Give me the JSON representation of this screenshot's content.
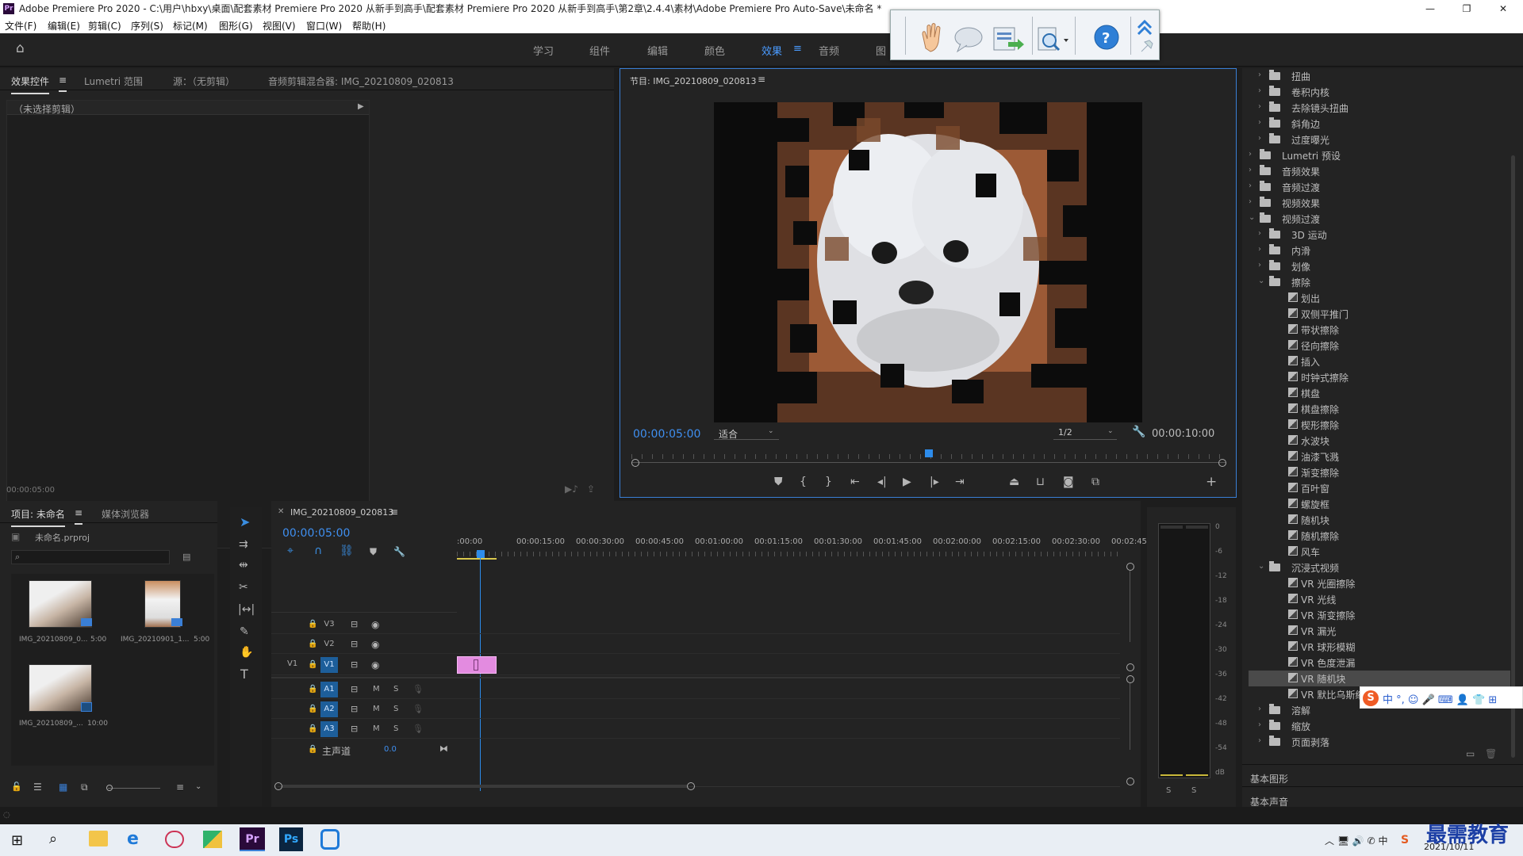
{
  "window": {
    "logo": "Pr",
    "title": "Adobe Premiere Pro 2020 - C:\\用户\\hbxy\\桌面\\配套素材 Premiere Pro 2020 从新手到高手\\配套素材 Premiere Pro 2020 从新手到高手\\第2章\\2.4.4\\素材\\Adobe Premiere Pro Auto-Save\\未命名 *",
    "minimize": "—",
    "maximize": "❐",
    "close": "✕"
  },
  "menu": [
    "文件(F)",
    "编辑(E)",
    "剪辑(C)",
    "序列(S)",
    "标记(M)",
    "图形(G)",
    "视图(V)",
    "窗口(W)",
    "帮助(H)"
  ],
  "workspaces": {
    "items": [
      "学习",
      "组件",
      "编辑",
      "颜色",
      "效果",
      "音频",
      "图"
    ],
    "active": "效果"
  },
  "source_panel": {
    "tabs": [
      "效果控件",
      "Lumetri 范围",
      "源：（无剪辑）",
      "音频剪辑混合器: IMG_20210809_020813"
    ],
    "no_clip": "（未选择剪辑）",
    "timecode": "00:00:05:00"
  },
  "program_panel": {
    "title": "节目: IMG_20210809_020813",
    "timecode": "00:00:05:00",
    "fit": "适合",
    "resolution": "1/2",
    "duration": "00:00:10:00",
    "playhead_fraction": 0.5
  },
  "project_panel": {
    "tabs": [
      "项目: 未命名",
      "媒体浏览器"
    ],
    "file": "未命名.prproj",
    "items": [
      {
        "name": "IMG_20210809_0...",
        "duration": "5:00"
      },
      {
        "name": "IMG_20210901_1...",
        "duration": "5:00"
      },
      {
        "name": "IMG_20210809_...",
        "duration": "10:00"
      }
    ]
  },
  "timeline": {
    "tab": "IMG_20210809_020813",
    "timecode": "00:00:05:00",
    "ruler": [
      ":00:00",
      "00:00:15:00",
      "00:00:30:00",
      "00:00:45:00",
      "00:01:00:00",
      "00:01:15:00",
      "00:01:30:00",
      "00:01:45:00",
      "00:02:00:00",
      "00:02:15:00",
      "00:02:30:00",
      "00:02:45:"
    ],
    "video_tracks": [
      "V3",
      "V2",
      "V1"
    ],
    "audio_tracks": [
      "A1",
      "A2",
      "A3"
    ],
    "source_patch": "V1",
    "mute": "M",
    "solo": "S",
    "master": "主声道",
    "master_value": "0.0"
  },
  "meter": {
    "ticks": [
      "0",
      "-6",
      "-12",
      "-18",
      "-24",
      "-30",
      "-36",
      "-42",
      "-48",
      "-54",
      "dB"
    ],
    "solo": [
      "S",
      "S"
    ]
  },
  "effects_tree": [
    {
      "label": "扭曲",
      "level": 1,
      "kind": "folder",
      "open": false
    },
    {
      "label": "卷积内核",
      "level": 1,
      "kind": "folder",
      "open": false
    },
    {
      "label": "去除镜头扭曲",
      "level": 1,
      "kind": "folder",
      "open": false
    },
    {
      "label": "斜角边",
      "level": 1,
      "kind": "folder",
      "open": false
    },
    {
      "label": "过度曝光",
      "level": 1,
      "kind": "folder",
      "open": false
    },
    {
      "label": "Lumetri 预设",
      "level": 0,
      "kind": "folder",
      "open": false
    },
    {
      "label": "音频效果",
      "level": 0,
      "kind": "folder",
      "open": false
    },
    {
      "label": "音频过渡",
      "level": 0,
      "kind": "folder",
      "open": false
    },
    {
      "label": "视频效果",
      "level": 0,
      "kind": "folder",
      "open": false
    },
    {
      "label": "视频过渡",
      "level": 0,
      "kind": "folder",
      "open": true
    },
    {
      "label": "3D 运动",
      "level": 1,
      "kind": "folder",
      "open": false
    },
    {
      "label": "内滑",
      "level": 1,
      "kind": "folder",
      "open": false
    },
    {
      "label": "划像",
      "level": 1,
      "kind": "folder",
      "open": false
    },
    {
      "label": "擦除",
      "level": 1,
      "kind": "folder",
      "open": true
    },
    {
      "label": "划出",
      "level": 2,
      "kind": "fx"
    },
    {
      "label": "双侧平推门",
      "level": 2,
      "kind": "fx"
    },
    {
      "label": "带状擦除",
      "level": 2,
      "kind": "fx"
    },
    {
      "label": "径向擦除",
      "level": 2,
      "kind": "fx"
    },
    {
      "label": "插入",
      "level": 2,
      "kind": "fx"
    },
    {
      "label": "时钟式擦除",
      "level": 2,
      "kind": "fx"
    },
    {
      "label": "棋盘",
      "level": 2,
      "kind": "fx"
    },
    {
      "label": "棋盘擦除",
      "level": 2,
      "kind": "fx"
    },
    {
      "label": "楔形擦除",
      "level": 2,
      "kind": "fx"
    },
    {
      "label": "水波块",
      "level": 2,
      "kind": "fx"
    },
    {
      "label": "油漆飞溅",
      "level": 2,
      "kind": "fx"
    },
    {
      "label": "渐变擦除",
      "level": 2,
      "kind": "fx"
    },
    {
      "label": "百叶窗",
      "level": 2,
      "kind": "fx"
    },
    {
      "label": "螺旋框",
      "level": 2,
      "kind": "fx"
    },
    {
      "label": "随机块",
      "level": 2,
      "kind": "fx"
    },
    {
      "label": "随机擦除",
      "level": 2,
      "kind": "fx"
    },
    {
      "label": "风车",
      "level": 2,
      "kind": "fx"
    },
    {
      "label": "沉浸式视频",
      "level": 1,
      "kind": "folder",
      "open": true
    },
    {
      "label": "VR 光圈擦除",
      "level": 2,
      "kind": "fx"
    },
    {
      "label": "VR 光线",
      "level": 2,
      "kind": "fx"
    },
    {
      "label": "VR 渐变擦除",
      "level": 2,
      "kind": "fx"
    },
    {
      "label": "VR 漏光",
      "level": 2,
      "kind": "fx"
    },
    {
      "label": "VR 球形模糊",
      "level": 2,
      "kind": "fx"
    },
    {
      "label": "VR 色度泄漏",
      "level": 2,
      "kind": "fx"
    },
    {
      "label": "VR 随机块",
      "level": 2,
      "kind": "fx",
      "selected": true
    },
    {
      "label": "VR 默比乌斯缩放",
      "level": 2,
      "kind": "fx"
    },
    {
      "label": "溶解",
      "level": 1,
      "kind": "folder",
      "open": false
    },
    {
      "label": "缩放",
      "level": 1,
      "kind": "folder",
      "open": false
    },
    {
      "label": "页面剥落",
      "level": 1,
      "kind": "folder",
      "open": false
    }
  ],
  "side_sections": [
    "基本图形",
    "基本声音"
  ],
  "ime_bar": "中 °, ☺ 🎤 ⌨ 👤 👕 ⊞",
  "taskbar": {
    "date": "2021/10/11",
    "watermark": "最需教育"
  },
  "colors": {
    "accent": "#2d8ceb",
    "clip": "#e38be0",
    "panel": "#232323",
    "frame": "#3a7fd6"
  }
}
